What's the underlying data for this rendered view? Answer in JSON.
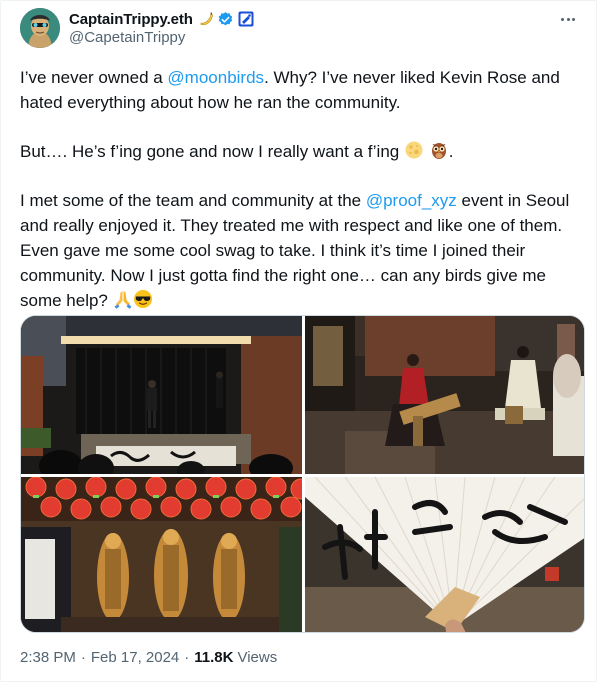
{
  "author": {
    "display_name": "CaptainTrippy.eth",
    "handle": "@CapetainTrippy",
    "name_emoji": "banana-icon",
    "verified_badge": "verified-badge-icon",
    "affiliation_badge": "affiliate-badge-icon"
  },
  "menu": {
    "more_icon": "more-options-icon"
  },
  "tweet": {
    "p1_a": "I’ve never owned a ",
    "p1_mention": "@moonbirds",
    "p1_b": ". Why? I’ve never liked Kevin Rose and hated everything about how he ran the community.",
    "p2_a": "But…. He’s f’ing gone and now I really want a f’ing ",
    "p2_emojis": [
      "moon-icon",
      "owl-icon"
    ],
    "p2_b": ".",
    "p3_a": "I met some of the team and community at the ",
    "p3_mention": "@proof_xyz",
    "p3_b": " event in Seoul and really enjoyed it. They treated me with respect and like one of them. Even gave me some cool swag to take. I think it’s time I joined their community. Now I just gotta find the right one… can any birds give me some help? ",
    "p3_emojis": [
      "folded-hands-icon",
      "sunglasses-face-icon"
    ]
  },
  "media": [
    {
      "name": "photo-performance-stage"
    },
    {
      "name": "photo-musician-performance"
    },
    {
      "name": "photo-buddha-lanterns"
    },
    {
      "name": "photo-calligraphy-fan"
    }
  ],
  "meta": {
    "time": "2:38 PM",
    "separator": "·",
    "date": "Feb 17, 2024",
    "views_count": "11.8K",
    "views_label": "Views"
  },
  "colors": {
    "link": "#1d9bf0",
    "secondary_text": "#536471",
    "text": "#0f1419",
    "verified": "#1d9bf0"
  }
}
